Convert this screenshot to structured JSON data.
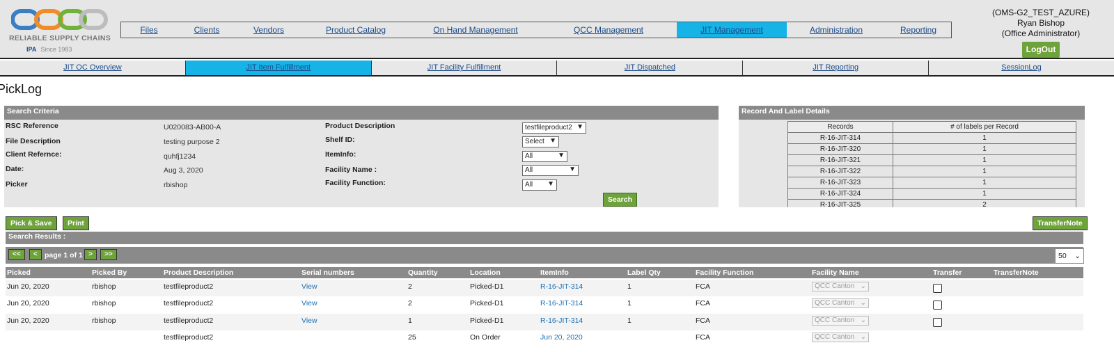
{
  "brand": {
    "name": "RELIABLE SUPPLY CHAINS",
    "since": "Since 1983",
    "partner": "IPA"
  },
  "mainnav": [
    {
      "label": "Files",
      "active": false,
      "w": 80
    },
    {
      "label": "Clients",
      "active": false,
      "w": 86
    },
    {
      "label": "Vendors",
      "active": false,
      "w": 92
    },
    {
      "label": "Product Catalog",
      "active": false,
      "w": 158
    },
    {
      "label": "On Hand Management",
      "active": false,
      "w": 186
    },
    {
      "label": "QCC Management",
      "active": false,
      "w": 196
    },
    {
      "label": "JIT Management",
      "active": true,
      "w": 158
    },
    {
      "label": "Administration",
      "active": false,
      "w": 142
    },
    {
      "label": "Reporting",
      "active": false,
      "w": 94
    }
  ],
  "user": {
    "env": "(OMS-G2_TEST_AZURE)",
    "name": "Ryan Bishop",
    "role": "(Office Administrator)",
    "logout": "LogOut"
  },
  "subnav": [
    {
      "label": "JIT OC Overview",
      "active": false
    },
    {
      "label": "JIT Item Fulfillment",
      "active": true
    },
    {
      "label": "JIT Facility Fulfillment",
      "active": false
    },
    {
      "label": "JIT Dispatched",
      "active": false
    },
    {
      "label": "JIT Reporting",
      "active": false
    },
    {
      "label": "SessionLog",
      "active": false
    }
  ],
  "page_title": "PickLog",
  "search": {
    "title": "Search Criteria",
    "rsc_label": "RSC Reference",
    "rsc_value": "U020083-AB00-A",
    "file_label": "File Description",
    "file_value": "testing purpose 2",
    "client_label": "Client Refernce:",
    "client_value": "quhfj1234",
    "date_label": "Date:",
    "date_value": "Aug 3, 2020",
    "picker_label": "Picker",
    "picker_value": "rbishop",
    "product_label": "Product Description",
    "product_value": "testfileproduct2",
    "shelf_label": "Shelf ID:",
    "shelf_value": "Select",
    "iteminfo_label": "ItemInfo:",
    "iteminfo_value": "All",
    "facname_label": "Facility Name :",
    "facname_value": "All",
    "facfunc_label": "Facility Function:",
    "facfunc_value": "All",
    "search_button": "Search"
  },
  "record": {
    "title": "Record And Label Details",
    "col_records": "Records",
    "col_labels": "# of labels per Record",
    "rows": [
      {
        "record": "R-16-JIT-314",
        "labels": "1"
      },
      {
        "record": "R-16-JIT-320",
        "labels": "1"
      },
      {
        "record": "R-16-JIT-321",
        "labels": "1"
      },
      {
        "record": "R-16-JIT-322",
        "labels": "1"
      },
      {
        "record": "R-16-JIT-323",
        "labels": "1"
      },
      {
        "record": "R-16-JIT-324",
        "labels": "1"
      },
      {
        "record": "R-16-JIT-325",
        "labels": "2"
      }
    ]
  },
  "actions": {
    "pick_save": "Pick & Save",
    "print": "Print",
    "transfer_note": "TransferNote"
  },
  "results": {
    "title": "Search Results :",
    "first": "<<",
    "prev": "<",
    "page_text": "page 1 of 1",
    "next": ">",
    "last": ">>",
    "page_size": "50",
    "columns": {
      "picked": "Picked",
      "picked_by": "Picked By",
      "product": "Product Description",
      "serial": "Serial numbers",
      "quantity": "Quantity",
      "location": "Location",
      "iteminfo": "ItemInfo",
      "labelqty": "Label Qty",
      "facfunc": "Facility Function",
      "facname": "Facility Name",
      "transfer": "Transfer",
      "transfernote": "TransferNote"
    },
    "rows": [
      {
        "picked": "Jun 20, 2020",
        "picked_by": "rbishop",
        "product": "testfileproduct2",
        "serial": "View",
        "quantity": "2",
        "location": "Picked-D1",
        "iteminfo": "R-16-JIT-314",
        "labelqty": "1",
        "facfunc": "FCA",
        "facname": "QCC Canton"
      },
      {
        "picked": "Jun 20, 2020",
        "picked_by": "rbishop",
        "product": "testfileproduct2",
        "serial": "View",
        "quantity": "2",
        "location": "Picked-D1",
        "iteminfo": "R-16-JIT-314",
        "labelqty": "1",
        "facfunc": "FCA",
        "facname": "QCC Canton"
      },
      {
        "picked": "Jun 20, 2020",
        "picked_by": "rbishop",
        "product": "testfileproduct2",
        "serial": "View",
        "quantity": "1",
        "location": "Picked-D1",
        "iteminfo": "R-16-JIT-314",
        "labelqty": "1",
        "facfunc": "FCA",
        "facname": "QCC Canton"
      },
      {
        "picked": "",
        "picked_by": "",
        "product": "testfileproduct2",
        "serial": "",
        "quantity": "25",
        "location": "On Order",
        "iteminfo": "Jun 20, 2020",
        "labelqty": "",
        "facfunc": "FCA",
        "facname": "QCC Canton"
      }
    ]
  }
}
